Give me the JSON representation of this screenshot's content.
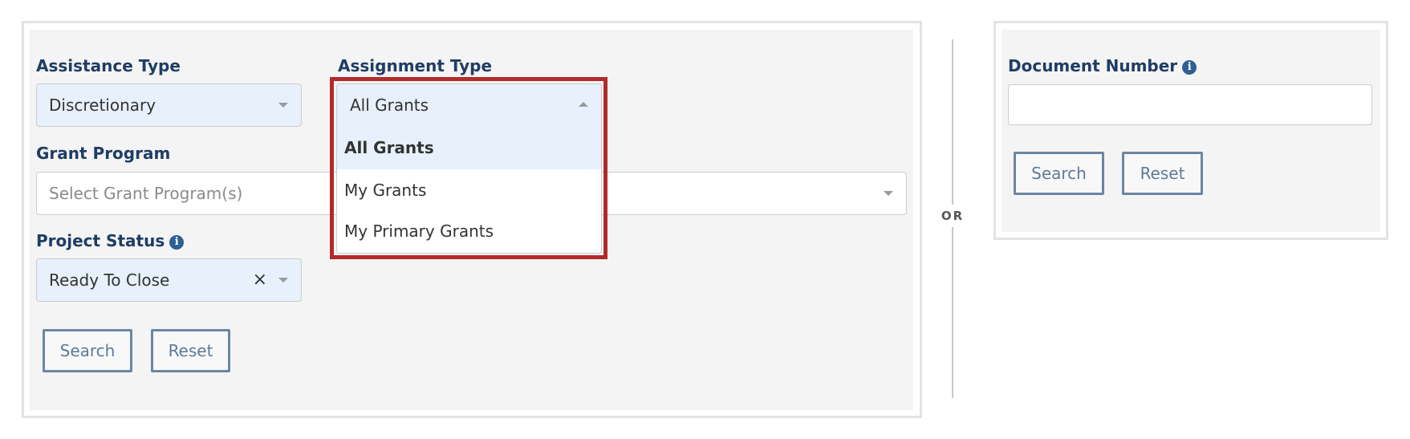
{
  "left_panel": {
    "assistance_type": {
      "label": "Assistance Type",
      "value": "Discretionary"
    },
    "assignment_type": {
      "label": "Assignment Type",
      "value": "All Grants",
      "options": [
        "All Grants",
        "My Grants",
        "My Primary Grants"
      ],
      "selected_index": 0
    },
    "grant_program": {
      "label": "Grant Program",
      "placeholder": "Select Grant Program(s)"
    },
    "project_status": {
      "label": "Project Status",
      "value": "Ready To Close",
      "clear_glyph": "×"
    },
    "search_label": "Search",
    "reset_label": "Reset"
  },
  "divider": {
    "label": "OR"
  },
  "right_panel": {
    "document_number": {
      "label": "Document Number",
      "value": ""
    },
    "search_label": "Search",
    "reset_label": "Reset"
  },
  "icons": {
    "info": "info-icon",
    "caret": "chevron-down-icon",
    "clear": "close-icon"
  },
  "colors": {
    "label": "#1f3d64",
    "highlight": "#b22a2a",
    "select_bg": "#e7f0fb",
    "button_border": "#6a86a3"
  }
}
